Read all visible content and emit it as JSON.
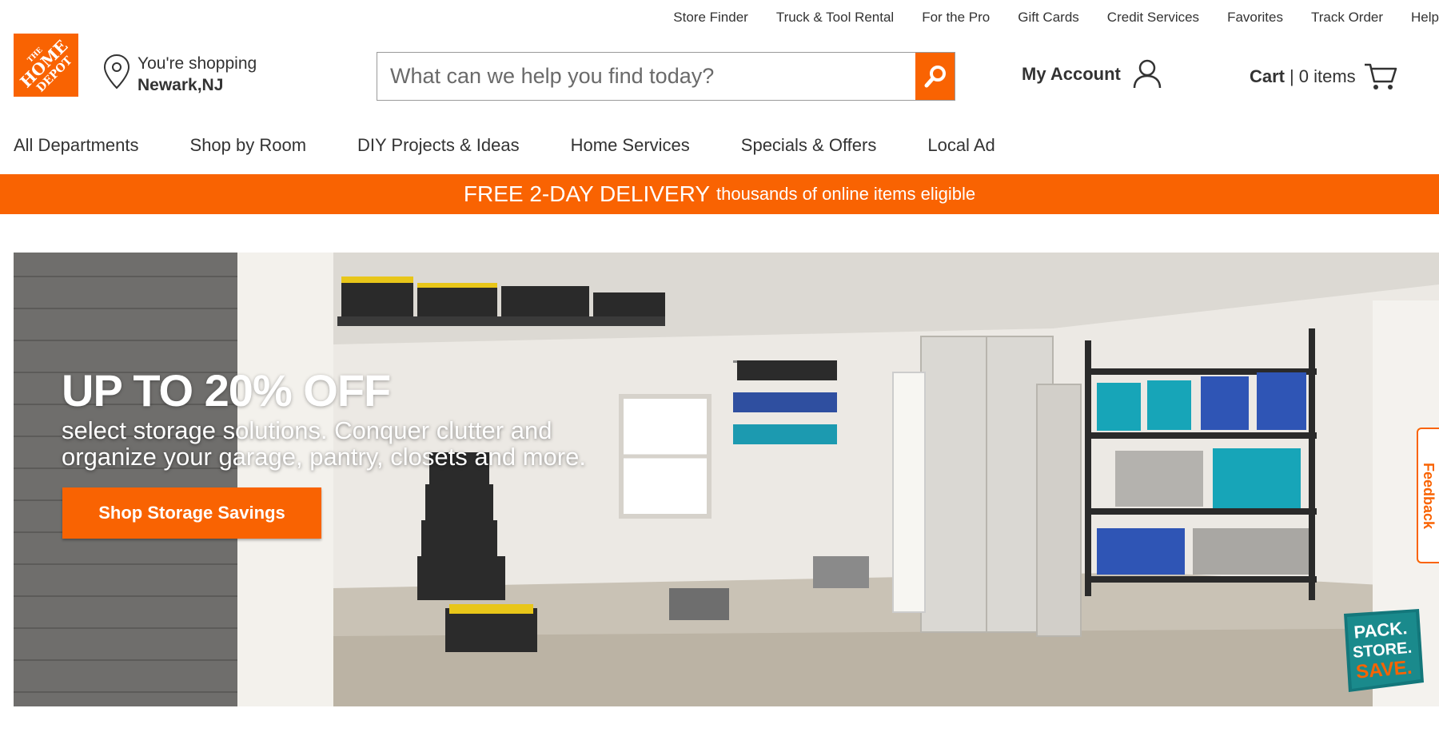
{
  "utility_nav": [
    "Store Finder",
    "Truck & Tool Rental",
    "For the Pro",
    "Gift Cards",
    "Credit Services",
    "Favorites",
    "Track Order",
    "Help"
  ],
  "logo": {
    "line1": "THE",
    "line2": "HOME",
    "line3": "DEPOT",
    "color": "#f96302"
  },
  "store": {
    "label": "You're shopping",
    "city": "Newark,NJ"
  },
  "search": {
    "placeholder": "What can we help you find today?",
    "value": ""
  },
  "account": {
    "label": "My Account"
  },
  "cart": {
    "label": "Cart",
    "separator": "|",
    "count": "0 items"
  },
  "main_nav": [
    "All Departments",
    "Shop by Room",
    "DIY Projects & Ideas",
    "Home Services",
    "Specials & Offers",
    "Local Ad"
  ],
  "promo": {
    "headline": "FREE 2-DAY DELIVERY",
    "detail": "thousands of online items eligible"
  },
  "hero": {
    "headline": "UP TO 20% OFF",
    "subtext": "select storage solutions. Conquer clutter and organize your garage, pantry, closets and more.",
    "cta": "Shop Storage Savings",
    "badge": [
      "PACK.",
      "STORE.",
      "SAVE."
    ]
  },
  "feedback": {
    "label": "Feedback"
  },
  "colors": {
    "brand_orange": "#f96302",
    "text": "#333333",
    "badge_teal": "#1a8a8c"
  }
}
